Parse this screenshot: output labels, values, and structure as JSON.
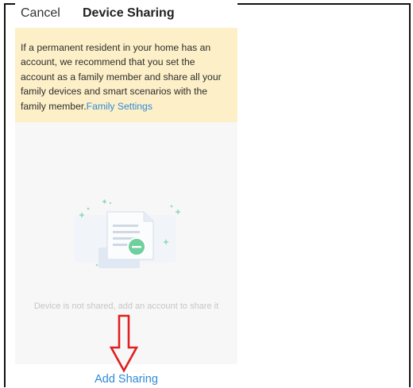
{
  "header": {
    "cancel_label": "Cancel",
    "title": "Device Sharing"
  },
  "notice": {
    "text": "If a permanent resident in your home has an account, we recommend that you set the account as a family member and share all your family devices and smart scenarios with the family member.",
    "link_label": "Family Settings"
  },
  "empty_state": {
    "illustration_icon": "shared-document-minus-icon",
    "message": "Device is not shared, add an account to share it"
  },
  "annotation": {
    "icon": "red-down-arrow-icon",
    "color": "#e02020"
  },
  "footer": {
    "add_sharing_label": "Add Sharing"
  },
  "colors": {
    "accent": "#2e8bd6",
    "notice_bg": "#fdf0c8",
    "empty_bg": "#f7f7f7",
    "illustration_green": "#6fcf9d"
  }
}
